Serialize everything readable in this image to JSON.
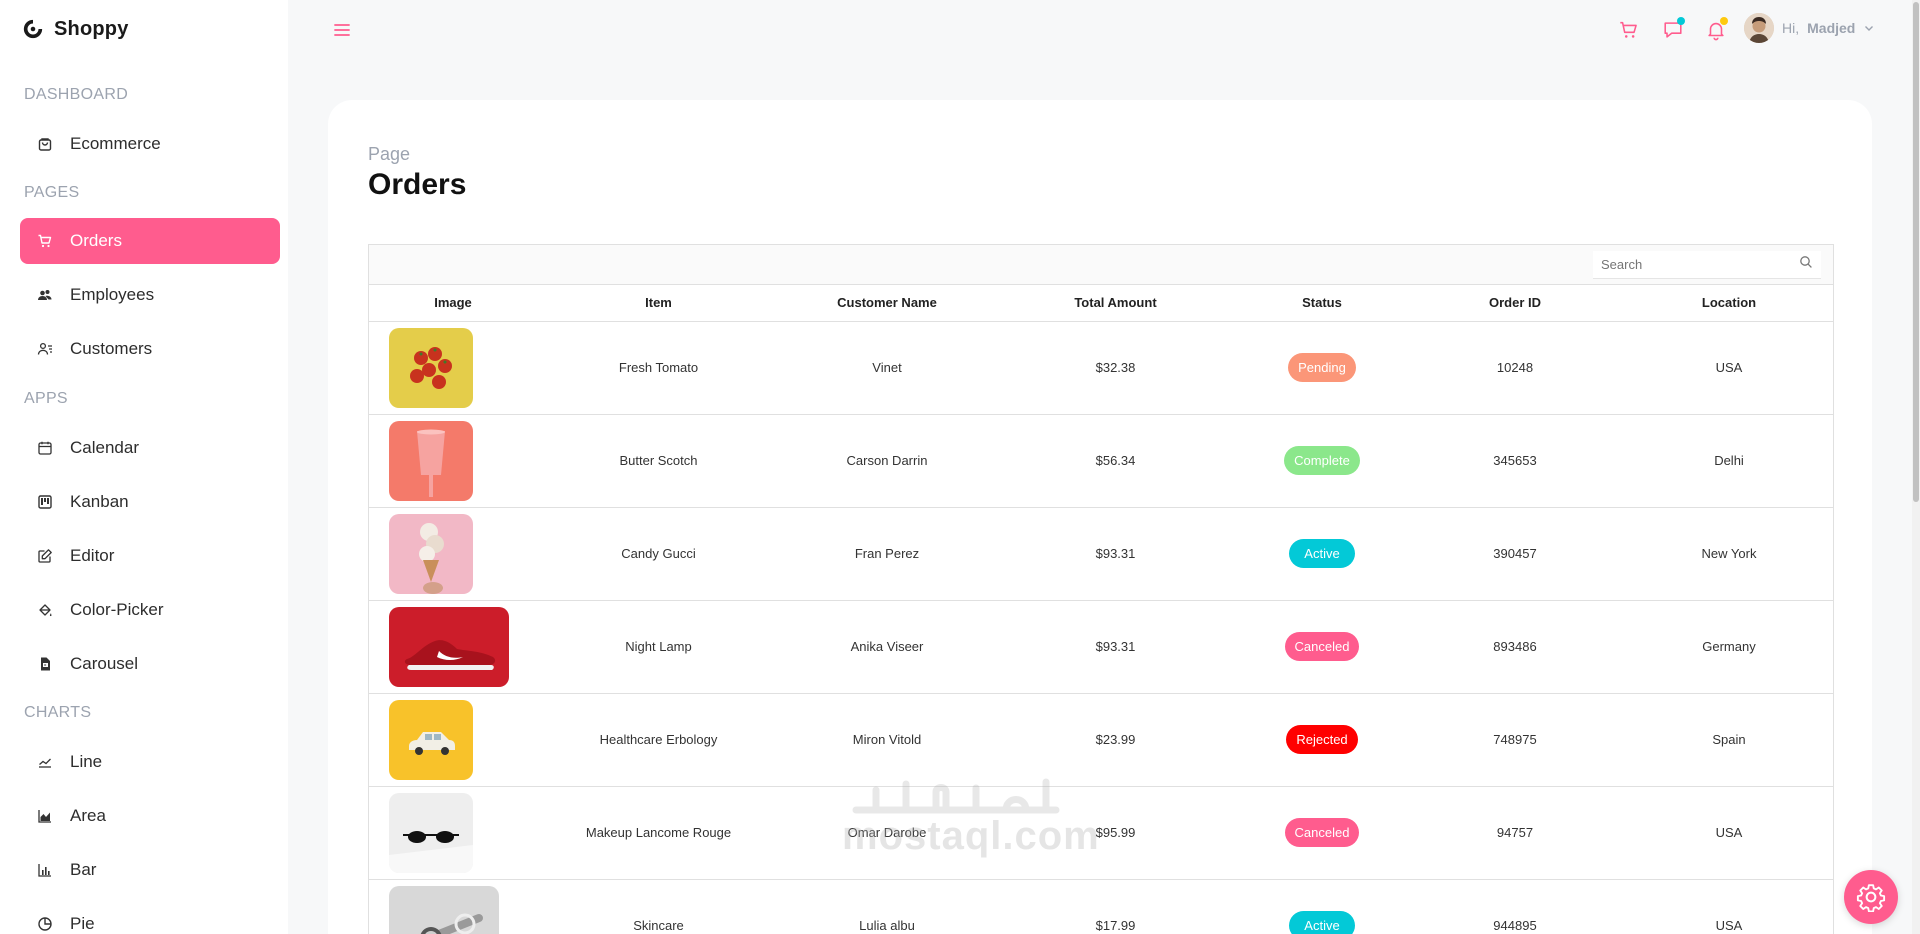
{
  "app": {
    "name": "Shoppy",
    "accent": "#ff5c8e"
  },
  "sidebar": {
    "sections": {
      "dashboard": "DASHBOARD",
      "pages": "PAGES",
      "apps": "APPS",
      "charts": "CHARTS"
    },
    "items": {
      "ecommerce": "Ecommerce",
      "orders": "Orders",
      "employees": "Employees",
      "customers": "Customers",
      "calendar": "Calendar",
      "kanban": "Kanban",
      "editor": "Editor",
      "color_picker": "Color-Picker",
      "carousel": "Carousel",
      "line": "Line",
      "area": "Area",
      "bar": "Bar",
      "pie": "Pie"
    },
    "active": "Orders"
  },
  "topbar": {
    "greeting": "Hi,",
    "username": "Madjed",
    "icons": [
      "menu-icon",
      "cart-icon",
      "chat-icon",
      "bell-icon",
      "chevron-down-icon"
    ],
    "chat_dot_color": "#03c9d7",
    "bell_dot_color": "#fec90f"
  },
  "page": {
    "crumb": "Page",
    "title": "Orders"
  },
  "grid": {
    "search_placeholder": "Search",
    "columns": [
      "Image",
      "Item",
      "Customer Name",
      "Total Amount",
      "Status",
      "Order ID",
      "Location"
    ],
    "rows": [
      {
        "item": "Fresh Tomato",
        "customer": "Vinet",
        "amount": "$32.38",
        "status": "Pending",
        "status_color": "#fb9678",
        "order_id": "10248",
        "location": "USA"
      },
      {
        "item": "Butter Scotch",
        "customer": "Carson Darrin",
        "amount": "$56.34",
        "status": "Complete",
        "status_color": "#8be78b",
        "order_id": "345653",
        "location": "Delhi"
      },
      {
        "item": "Candy Gucci",
        "customer": "Fran Perez",
        "amount": "$93.31",
        "status": "Active",
        "status_color": "#03c9d7",
        "order_id": "390457",
        "location": "New York"
      },
      {
        "item": "Night Lamp",
        "customer": "Anika Viseer",
        "amount": "$93.31",
        "status": "Canceled",
        "status_color": "#ff5c8e",
        "order_id": "893486",
        "location": "Germany"
      },
      {
        "item": "Healthcare Erbology",
        "customer": "Miron Vitold",
        "amount": "$23.99",
        "status": "Rejected",
        "status_color": "#ff0000",
        "order_id": "748975",
        "location": "Spain"
      },
      {
        "item": "Makeup Lancome Rouge",
        "customer": "Omar Darobe",
        "amount": "$95.99",
        "status": "Canceled",
        "status_color": "#ff5c8e",
        "order_id": "94757",
        "location": "USA"
      },
      {
        "item": "Skincare",
        "customer": "Lulia albu",
        "amount": "$17.99",
        "status": "Active",
        "status_color": "#03c9d7",
        "order_id": "944895",
        "location": "USA"
      }
    ]
  },
  "watermark": {
    "text": "mostaql.com"
  }
}
